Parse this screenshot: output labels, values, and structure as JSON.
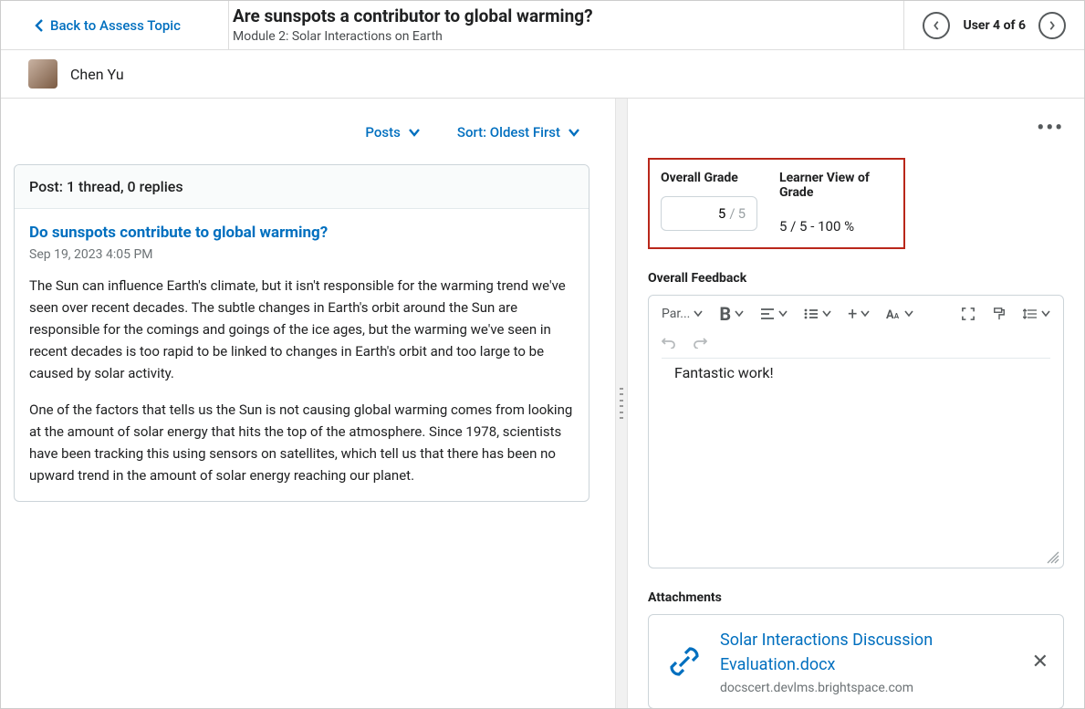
{
  "header": {
    "back_label": "Back to Assess Topic",
    "title": "Are sunspots a contributor to global warming?",
    "module": "Module 2: Solar Interactions on Earth",
    "user_nav": "User 4 of 6"
  },
  "student": {
    "name": "Chen Yu"
  },
  "filters": {
    "posts": "Posts",
    "sort": "Sort: Oldest First"
  },
  "post": {
    "summary": "Post: 1 thread, 0 replies",
    "title": "Do sunspots contribute to global warming?",
    "date": "Sep 19, 2023 4:05 PM",
    "para1": "The Sun can influence Earth's climate, but it isn't responsible for the warming trend we've seen over recent decades. The subtle changes in Earth's orbit around the Sun are responsible for the comings and goings of the ice ages, but the warming we've seen in recent decades is too rapid to be linked to changes in Earth's orbit and too large to be caused by solar activity.",
    "para2": "One of the factors that tells us the Sun is not causing global warming comes from looking at the amount of solar energy that hits the top of the atmosphere. Since 1978, scientists have been tracking this using sensors on satellites, which tell us that there has been no upward trend in the amount of solar energy reaching our planet."
  },
  "grading": {
    "overall_grade_label": "Overall Grade",
    "learner_view_label": "Learner View of Grade",
    "grade_value": "5",
    "grade_max": "5",
    "learner_view_text": "5 / 5 - 100 %",
    "feedback_label": "Overall Feedback",
    "feedback_text": "Fantastic work!",
    "paragraph_tool": "Par...",
    "attachments_label": "Attachments",
    "attachment_name": "Solar Interactions Discussion Evaluation.docx",
    "attachment_domain": "docscert.devlms.brightspace.com"
  }
}
